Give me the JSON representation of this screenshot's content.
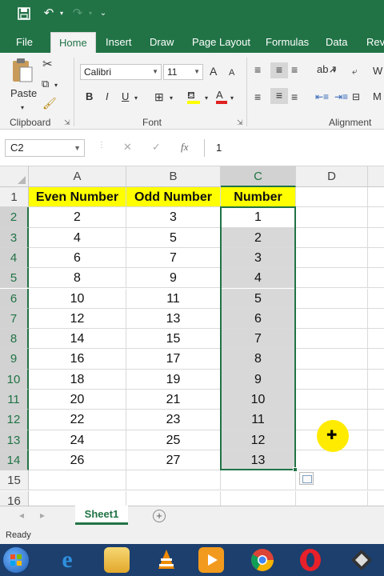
{
  "qat": {
    "save_icon": "save-icon",
    "undo_icon": "undo-icon",
    "redo_icon": "redo-icon",
    "customize_icon": "customize-qat-icon"
  },
  "tabs": [
    "File",
    "Home",
    "Insert",
    "Draw",
    "Page Layout",
    "Formulas",
    "Data",
    "Revi"
  ],
  "ribbon": {
    "clipboard": {
      "paste_label": "Paste",
      "group_label": "Clipboard"
    },
    "font": {
      "font_name": "Calibri",
      "font_size": "11",
      "bold": "B",
      "italic": "I",
      "underline": "U",
      "grow": "A",
      "shrink": "A",
      "fill_letter": "",
      "font_color_letter": "A",
      "group_label": "Font"
    },
    "alignment": {
      "group_label": "Alignment",
      "wrap_partial": "W",
      "merge_partial": "M"
    }
  },
  "formula_bar": {
    "name_box": "C2",
    "cancel": "✕",
    "enter": "✓",
    "fx": "fx",
    "value": "1"
  },
  "columns": [
    "A",
    "B",
    "C",
    "D"
  ],
  "rows": [
    "1",
    "2",
    "3",
    "4",
    "5",
    "6",
    "7",
    "8",
    "9",
    "10",
    "11",
    "12",
    "13",
    "14",
    "15",
    "16"
  ],
  "table": {
    "headers": [
      "Even Number",
      "Odd Number",
      "Number"
    ],
    "data": [
      [
        "2",
        "3",
        "1"
      ],
      [
        "4",
        "5",
        "2"
      ],
      [
        "6",
        "7",
        "3"
      ],
      [
        "8",
        "9",
        "4"
      ],
      [
        "10",
        "11",
        "5"
      ],
      [
        "12",
        "13",
        "6"
      ],
      [
        "14",
        "15",
        "7"
      ],
      [
        "16",
        "17",
        "8"
      ],
      [
        "18",
        "19",
        "9"
      ],
      [
        "20",
        "21",
        "10"
      ],
      [
        "22",
        "23",
        "11"
      ],
      [
        "24",
        "25",
        "12"
      ],
      [
        "26",
        "27",
        "13"
      ]
    ]
  },
  "sheets": {
    "active": "Sheet1"
  },
  "status": {
    "text": "Ready"
  },
  "colors": {
    "excel_green": "#217346",
    "header_fill": "#ffff00",
    "selection_fill": "#d8d8d8",
    "taskbar": "#1c3f6e"
  },
  "taskbar": [
    "start-orb-icon",
    "internet-explorer-icon",
    "file-explorer-icon",
    "vlc-icon",
    "media-player-icon",
    "chrome-icon",
    "opera-icon",
    "app-icon"
  ]
}
